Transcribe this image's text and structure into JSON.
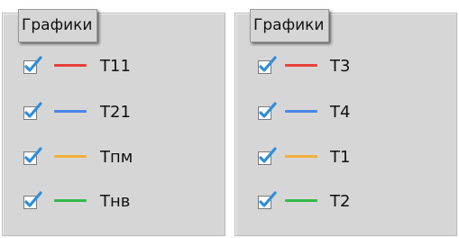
{
  "left_panel": {
    "title": "Графики",
    "items": [
      {
        "label": "T11",
        "color": "#e8423c",
        "checked": true
      },
      {
        "label": "T21",
        "color": "#4a86e8",
        "checked": true
      },
      {
        "label": "Tпм",
        "color": "#f4b03c",
        "checked": true
      },
      {
        "label": "Tнв",
        "color": "#34b94a",
        "checked": true
      }
    ]
  },
  "right_panel": {
    "title": "Графики",
    "items": [
      {
        "label": "T3",
        "color": "#e8423c",
        "checked": true
      },
      {
        "label": "T4",
        "color": "#4a86e8",
        "checked": true
      },
      {
        "label": "T1",
        "color": "#f4b03c",
        "checked": true
      },
      {
        "label": "T2",
        "color": "#34b94a",
        "checked": true
      }
    ]
  }
}
